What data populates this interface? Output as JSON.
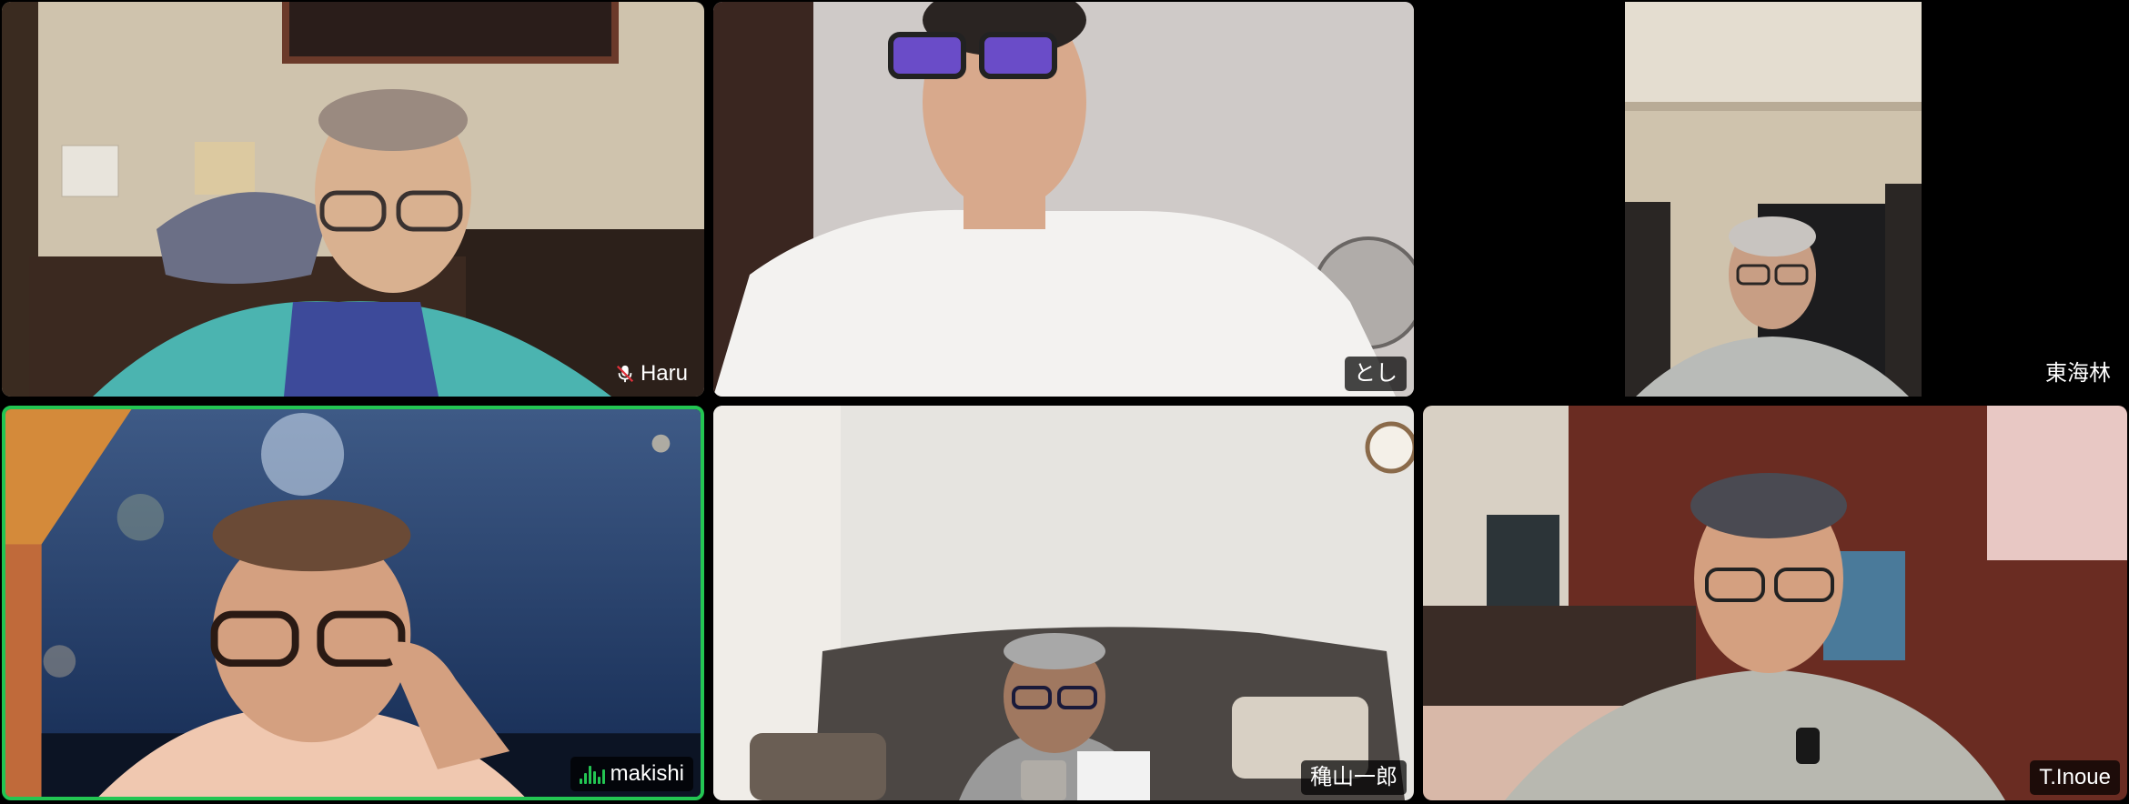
{
  "participants": [
    {
      "name": "Haru",
      "muted": true,
      "active": false
    },
    {
      "name": "とし",
      "muted": false,
      "active": false
    },
    {
      "name": "東海林",
      "muted": false,
      "active": false
    },
    {
      "name": "makishi",
      "muted": false,
      "active": true,
      "speaking": true
    },
    {
      "name": "穐山一郎",
      "muted": false,
      "active": false
    },
    {
      "name": "T.Inoue",
      "muted": false,
      "active": false
    }
  ],
  "colors": {
    "active_border": "#23c552",
    "background": "#000000"
  },
  "icons": {
    "muted": "microphone-off-icon",
    "speaking": "audio-level-icon"
  }
}
